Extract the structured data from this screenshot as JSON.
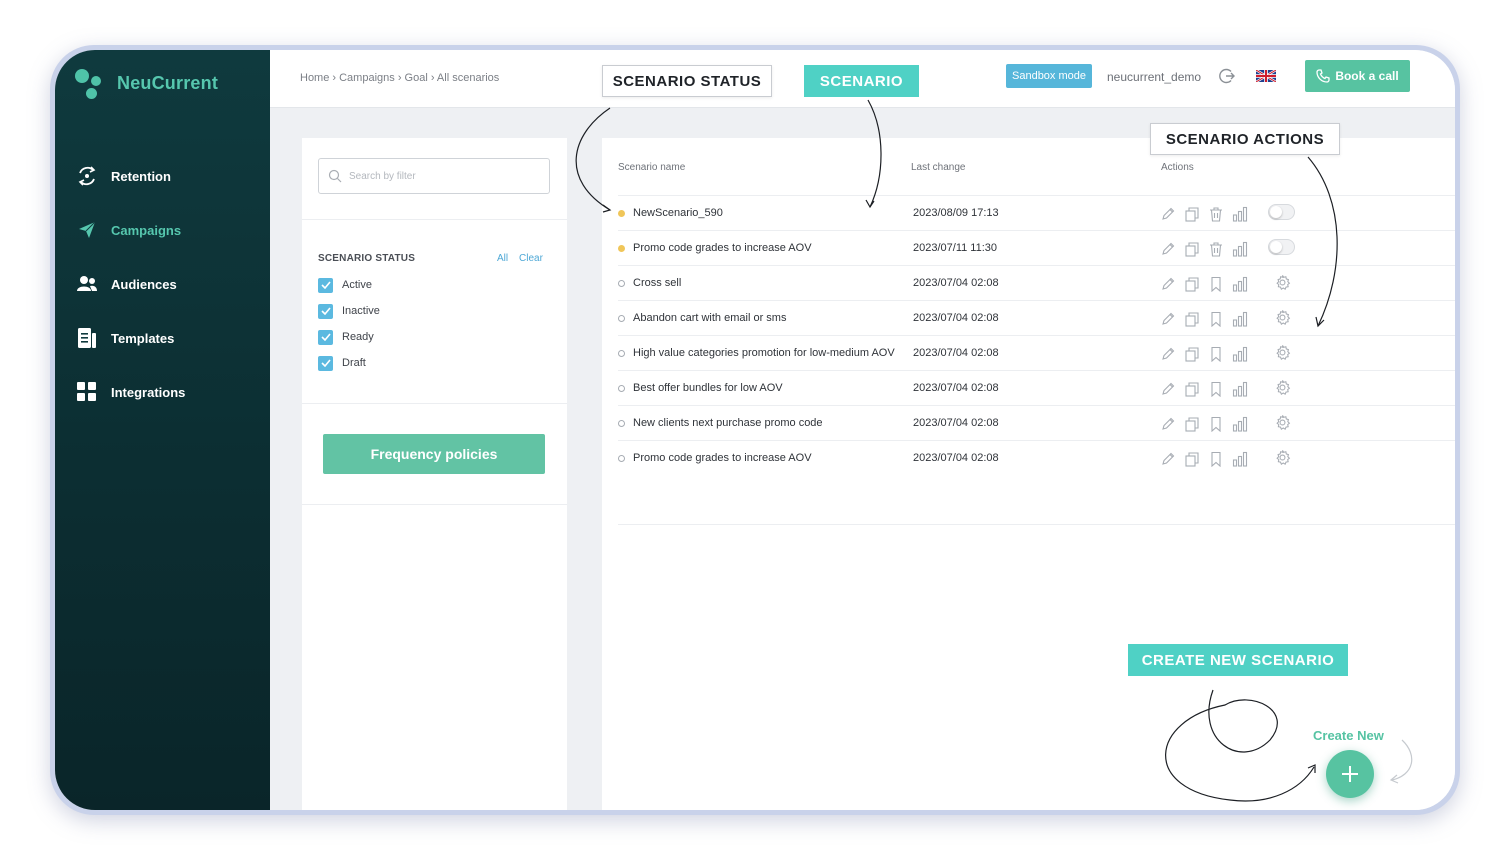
{
  "app": {
    "logo_text": "NeuCurrent"
  },
  "sidebar": {
    "items": [
      {
        "label": "Retention",
        "icon": "retention-icon"
      },
      {
        "label": "Campaigns",
        "icon": "paper-plane-icon",
        "active": true
      },
      {
        "label": "Audiences",
        "icon": "users-icon"
      },
      {
        "label": "Templates",
        "icon": "template-icon"
      },
      {
        "label": "Integrations",
        "icon": "grid-icon"
      }
    ]
  },
  "header": {
    "breadcrumb": "Home › Campaigns › Goal › All scenarios",
    "sandbox_label": "Sandbox mode",
    "username": "neucurrent_demo",
    "book_call_label": "Book a call"
  },
  "filter": {
    "search_placeholder": "Search by filter",
    "status_title": "SCENARIO STATUS",
    "all_label": "All",
    "clear_label": "Clear",
    "statuses": [
      {
        "label": "Active",
        "checked": true
      },
      {
        "label": "Inactive",
        "checked": true
      },
      {
        "label": "Ready",
        "checked": true
      },
      {
        "label": "Draft",
        "checked": true
      }
    ],
    "frequency_button": "Frequency policies"
  },
  "table": {
    "columns": [
      "Scenario name",
      "Last change",
      "Actions"
    ],
    "rows": [
      {
        "name": "NewScenario_590",
        "date": "2023/08/09 17:13",
        "status": "yellow",
        "last_action": "toggle"
      },
      {
        "name": "Promo code grades to increase AOV",
        "date": "2023/07/11 11:30",
        "status": "yellow",
        "last_action": "toggle"
      },
      {
        "name": "Cross sell",
        "date": "2023/07/04 02:08",
        "status": "empty",
        "last_action": "gear"
      },
      {
        "name": "Abandon cart with email or sms",
        "date": "2023/07/04 02:08",
        "status": "empty",
        "last_action": "gear"
      },
      {
        "name": "High value categories promotion for low-medium AOV",
        "date": "2023/07/04 02:08",
        "status": "empty",
        "last_action": "gear"
      },
      {
        "name": "Best offer bundles for low AOV",
        "date": "2023/07/04 02:08",
        "status": "empty",
        "last_action": "gear"
      },
      {
        "name": "New clients next purchase promo code",
        "date": "2023/07/04 02:08",
        "status": "empty",
        "last_action": "gear"
      },
      {
        "name": "Promo code grades to increase AOV",
        "date": "2023/07/04 02:08",
        "status": "empty",
        "last_action": "gear"
      }
    ]
  },
  "create": {
    "label": "Create New"
  },
  "callouts": {
    "scenario_status": "SCENARIO STATUS",
    "scenario": "SCENARIO",
    "scenario_actions": "SCENARIO ACTIONS",
    "create_new_scenario": "CREATE NEW SCENARIO"
  },
  "colors": {
    "accent": "#57c3a1",
    "sidebar": "#0f3a3e",
    "callout_teal": "#4fd1c5",
    "link_blue": "#4ea8d6",
    "status_yellow": "#f0c659"
  }
}
